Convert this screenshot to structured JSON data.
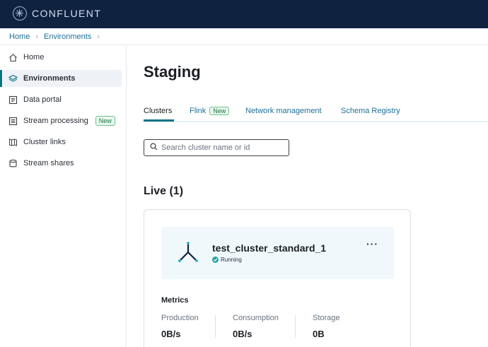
{
  "app": {
    "brand": "CONFLUENT"
  },
  "breadcrumb": [
    {
      "label": "Home"
    },
    {
      "label": "Environments"
    }
  ],
  "sidebar": {
    "items": [
      {
        "label": "Home",
        "icon": "home-icon"
      },
      {
        "label": "Environments",
        "icon": "layers-icon",
        "active": true
      },
      {
        "label": "Data portal",
        "icon": "portal-icon"
      },
      {
        "label": "Stream processing",
        "icon": "stream-icon",
        "badge": "New"
      },
      {
        "label": "Cluster links",
        "icon": "links-icon"
      },
      {
        "label": "Stream shares",
        "icon": "database-icon"
      }
    ]
  },
  "page": {
    "title": "Staging"
  },
  "tabs": [
    {
      "label": "Clusters",
      "active": true
    },
    {
      "label": "Flink",
      "badge": "New"
    },
    {
      "label": "Network management"
    },
    {
      "label": "Schema Registry"
    }
  ],
  "search": {
    "placeholder": "Search cluster name or id",
    "value": ""
  },
  "section": {
    "title": "Live (1)"
  },
  "cluster": {
    "name": "test_cluster_standard_1",
    "status": "Running",
    "more_label": "···",
    "metrics_title": "Metrics",
    "metrics": [
      {
        "label": "Production",
        "value": "0B/s"
      },
      {
        "label": "Consumption",
        "value": "0B/s"
      },
      {
        "label": "Storage",
        "value": "0B"
      }
    ]
  },
  "colors": {
    "topbar": "#0f2340",
    "link": "#1d6f9a",
    "accent": "#0b7285",
    "status": "#25a5a0",
    "badge_green": "#177a3f"
  }
}
